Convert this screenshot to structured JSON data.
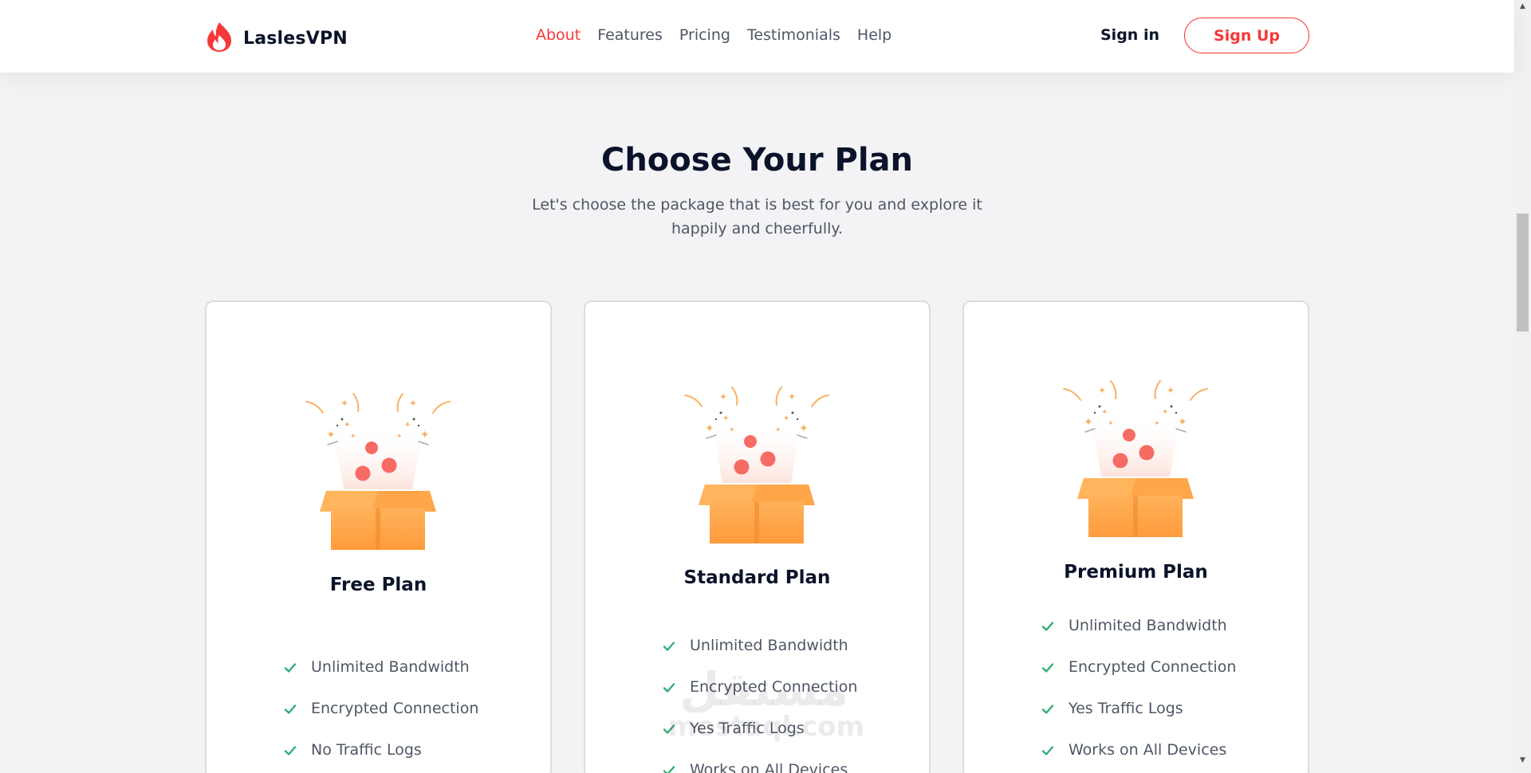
{
  "header": {
    "logo_text": "LaslesVPN",
    "nav": [
      "About",
      "Features",
      "Pricing",
      "Testimonials",
      "Help"
    ],
    "active_nav": "About",
    "sign_in": "Sign in",
    "sign_up": "Sign Up"
  },
  "section": {
    "title": "Choose Your Plan",
    "subtitle_line1": "Let's choose the package that is best for you and explore it",
    "subtitle_line2": "happily and cheerfully."
  },
  "plans": [
    {
      "name": "Free Plan",
      "features": [
        "Unlimited Bandwidth",
        "Encrypted Connection",
        "No Traffic Logs"
      ]
    },
    {
      "name": "Standard Plan",
      "features": [
        "Unlimited Bandwidth",
        "Encrypted Connection",
        "Yes Traffic Logs",
        "Works on All Devices"
      ]
    },
    {
      "name": "Premium Plan",
      "features": [
        "Unlimited Bandwidth",
        "Encrypted Connection",
        "Yes Traffic Logs",
        "Works on All Devices"
      ]
    }
  ],
  "watermark": {
    "arabic": "مستقل",
    "latin": "mostaql.com"
  },
  "colors": {
    "accent": "#f53838",
    "check": "#2fab73",
    "box": "#ff9b3d",
    "ball": "#f66b63"
  },
  "icons": {
    "logo": "flame-logo-icon",
    "feature": "check-icon",
    "illustration": "gift-box-icon"
  }
}
